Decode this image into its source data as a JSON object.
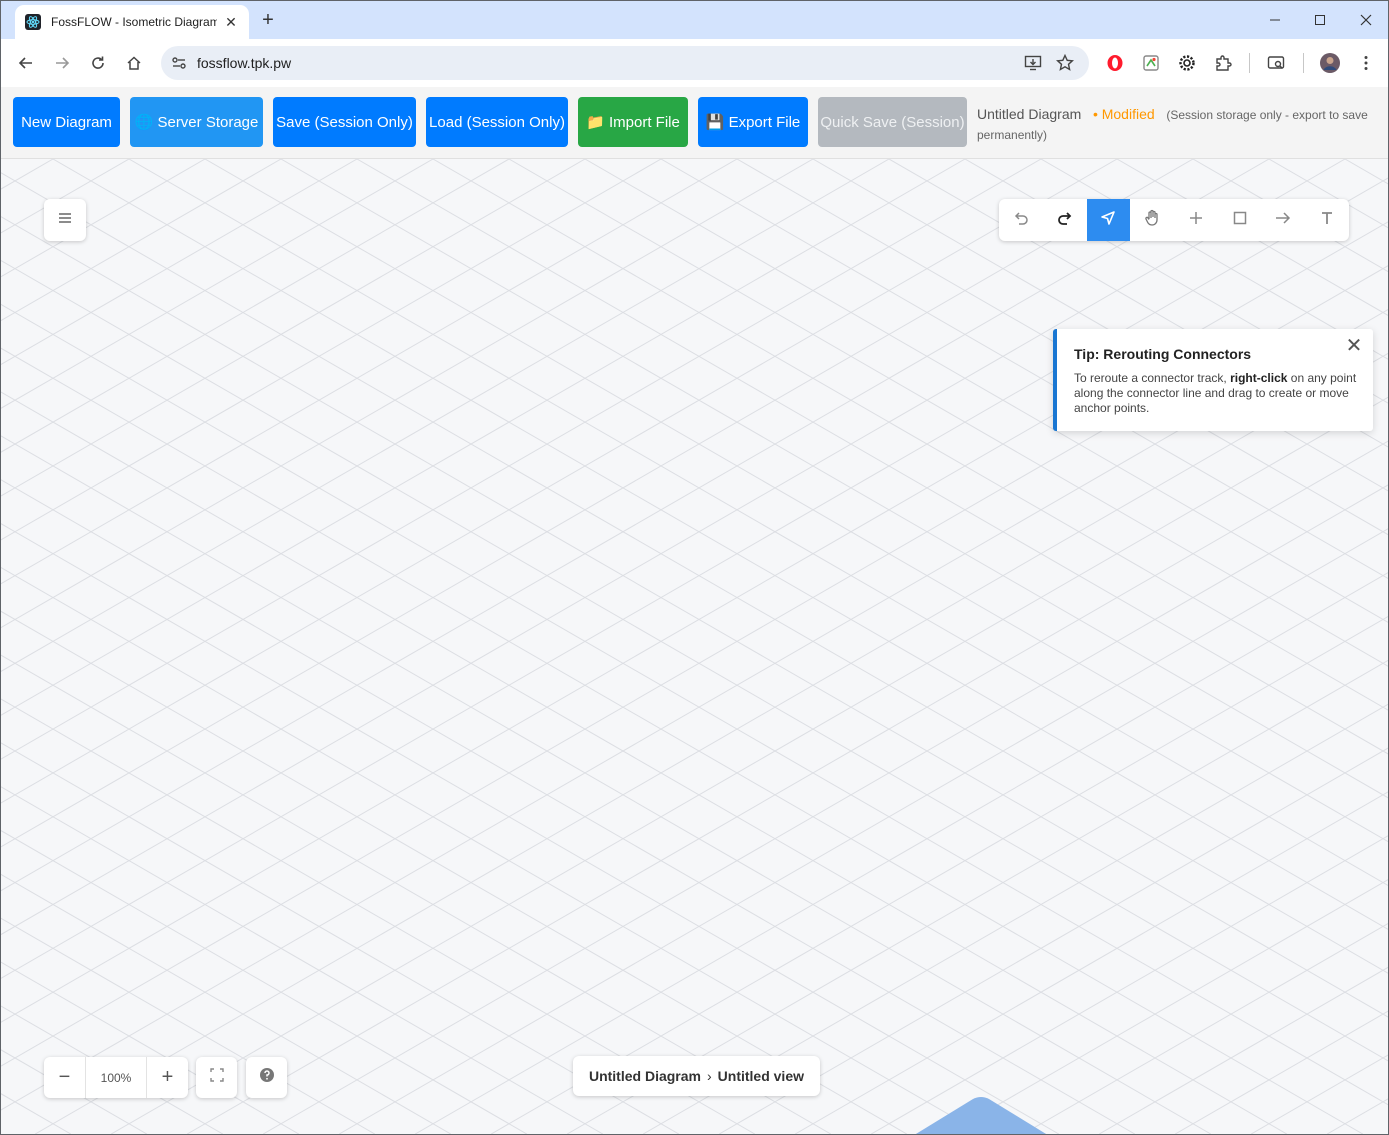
{
  "browser": {
    "tab_title": "FossFLOW - Isometric Diagramm",
    "url": "fossflow.tpk.pw",
    "new_tab_symbol": "+",
    "close_tab_symbol": "✕"
  },
  "app": {
    "buttons": {
      "new_diagram": "New Diagram",
      "server_storage": "🌐 Server Storage",
      "save_session": "Save (Session Only)",
      "load_session": "Load (Session Only)",
      "import_file": "📁 Import File",
      "export_file": "💾 Export File",
      "quick_save": "Quick Save (Session)"
    },
    "status": {
      "title": "Untitled Diagram",
      "modified": "• Modified",
      "note": "(Session storage only - export to save permanently)"
    },
    "tip": {
      "title": "Tip: Rerouting Connectors",
      "body_before": "To reroute a connector track, ",
      "body_bold": "right-click",
      "body_after": " on any point along the connector line and drag to create or move anchor points.",
      "close": "✕"
    },
    "zoom": {
      "minus": "−",
      "value": "100%",
      "plus": "+"
    },
    "breadcrumb": {
      "diagram": "Untitled Diagram",
      "separator": "›",
      "view": "Untitled view"
    },
    "tools": [
      "undo-icon",
      "redo-icon",
      "select-icon",
      "pan-icon",
      "add-icon",
      "rectangle-icon",
      "connector-icon",
      "text-icon"
    ],
    "colors": {
      "primary": "#007bff",
      "server": "#2196f3",
      "import": "#28a745",
      "disabled": "#b4b9bf",
      "modified": "#ff9800",
      "tool_active": "#2d8cf0",
      "tip_accent": "#1976d2"
    }
  }
}
